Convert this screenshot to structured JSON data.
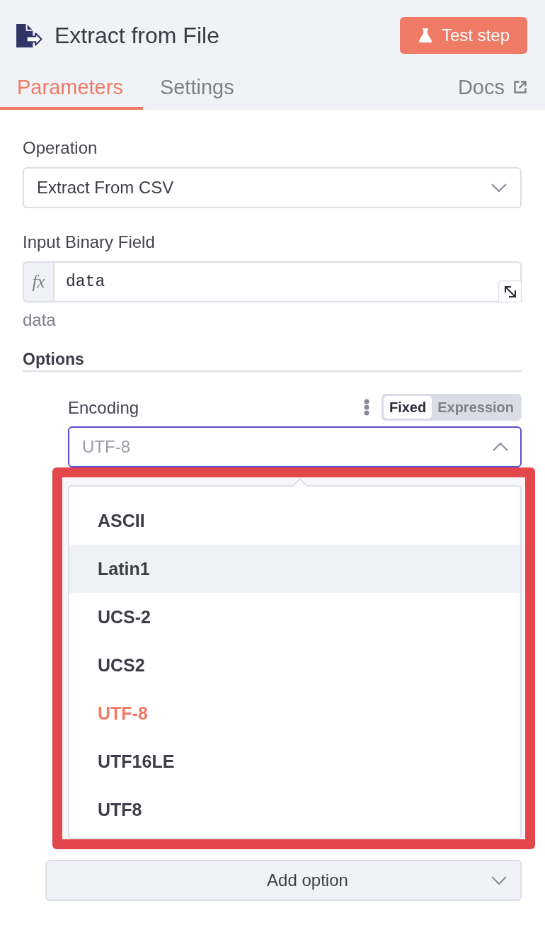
{
  "header": {
    "title": "Extract from File",
    "action": "Test step"
  },
  "tabs": [
    {
      "label": "Parameters",
      "selected": true
    },
    {
      "label": "Settings",
      "selected": false
    }
  ],
  "docs_link": "Docs",
  "parameters": [
    {
      "kind": "select",
      "label": "Operation",
      "value": "Extract From CSV"
    },
    {
      "kind": "expression",
      "label": "Input Binary Field",
      "prefix": "fx",
      "value": "data",
      "hint": "data"
    }
  ],
  "options": {
    "title": "Options",
    "items": [
      {
        "label": "Encoding",
        "modes": [
          {
            "label": "Fixed",
            "selected": true
          },
          {
            "label": "Expression",
            "selected": false
          }
        ],
        "placeholder": "UTF-8",
        "expanded": true,
        "choices": [
          {
            "label": "ASCII",
            "highlighted": false,
            "selected": false
          },
          {
            "label": "Latin1",
            "highlighted": true,
            "selected": false
          },
          {
            "label": "UCS-2",
            "highlighted": false,
            "selected": false
          },
          {
            "label": "UCS2",
            "highlighted": false,
            "selected": false
          },
          {
            "label": "UTF-8",
            "highlighted": false,
            "selected": true
          },
          {
            "label": "UTF16LE",
            "highlighted": false,
            "selected": false
          },
          {
            "label": "UTF8",
            "highlighted": false,
            "selected": false
          }
        ]
      }
    ],
    "add_button": "Add option"
  }
}
